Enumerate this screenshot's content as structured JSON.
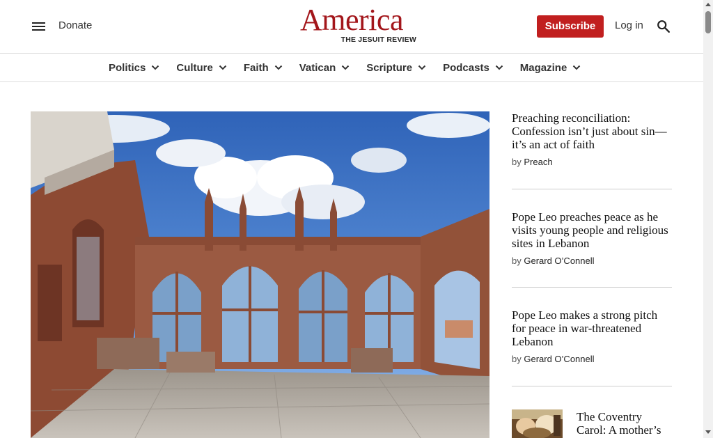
{
  "header": {
    "donate_label": "Donate",
    "logo_word": "America",
    "logo_sub": "THE JESUIT REVIEW",
    "subscribe_label": "Subscribe",
    "login_label": "Log in"
  },
  "nav": {
    "items": [
      {
        "label": "Politics"
      },
      {
        "label": "Culture"
      },
      {
        "label": "Faith"
      },
      {
        "label": "Vatican"
      },
      {
        "label": "Scripture"
      },
      {
        "label": "Podcasts"
      },
      {
        "label": "Magazine"
      }
    ]
  },
  "sidebar": {
    "stories": [
      {
        "title": "Preaching reconciliation: Confession isn’t just about sin—it’s an act of faith",
        "by": "by",
        "author": "Preach"
      },
      {
        "title": "Pope Leo preaches peace as he visits young people and religious sites in Lebanon",
        "by": "by",
        "author": "Gerard O’Connell"
      },
      {
        "title": "Pope Leo makes a strong pitch for peace in war-threatened Lebanon",
        "by": "by",
        "author": "Gerard O’Connell"
      },
      {
        "title": "The Coventry Carol: A mother’s"
      }
    ]
  },
  "colors": {
    "brand_red": "#a3161b",
    "subscribe_bg": "#c11f1f"
  },
  "icons": {
    "menu": "menu-icon",
    "search": "search-icon",
    "nav_chevron": "chevron-down-icon"
  }
}
